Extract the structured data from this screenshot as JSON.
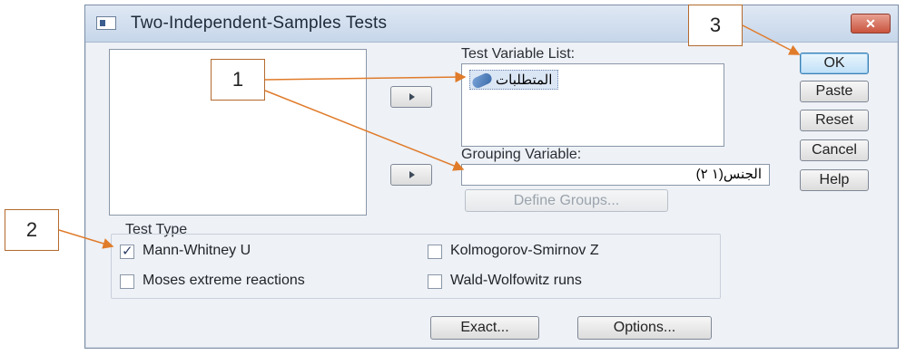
{
  "dialog": {
    "title": "Two-Independent-Samples Tests",
    "close_label": "✕"
  },
  "test_variable": {
    "label": "Test Variable List:",
    "items": [
      "المتطلبات"
    ]
  },
  "grouping_variable": {
    "label": "Grouping Variable:",
    "value": "الجنس(١ ٢)",
    "define_groups_label": "Define Groups..."
  },
  "side_buttons": {
    "ok": "OK",
    "paste": "Paste",
    "reset": "Reset",
    "cancel": "Cancel",
    "help": "Help"
  },
  "test_type": {
    "label": "Test Type",
    "options": [
      {
        "label": "Mann-Whitney U",
        "checked": true
      },
      {
        "label": "Kolmogorov-Smirnov Z",
        "checked": false
      },
      {
        "label": "Moses extreme reactions",
        "checked": false
      },
      {
        "label": "Wald-Wolfowitz runs",
        "checked": false
      }
    ]
  },
  "bottom_buttons": {
    "exact": "Exact...",
    "options": "Options..."
  },
  "callouts": [
    "1",
    "2",
    "3"
  ],
  "colors": {
    "accent_arrow": "#e07b2a",
    "callout_border": "#b46a2e"
  }
}
